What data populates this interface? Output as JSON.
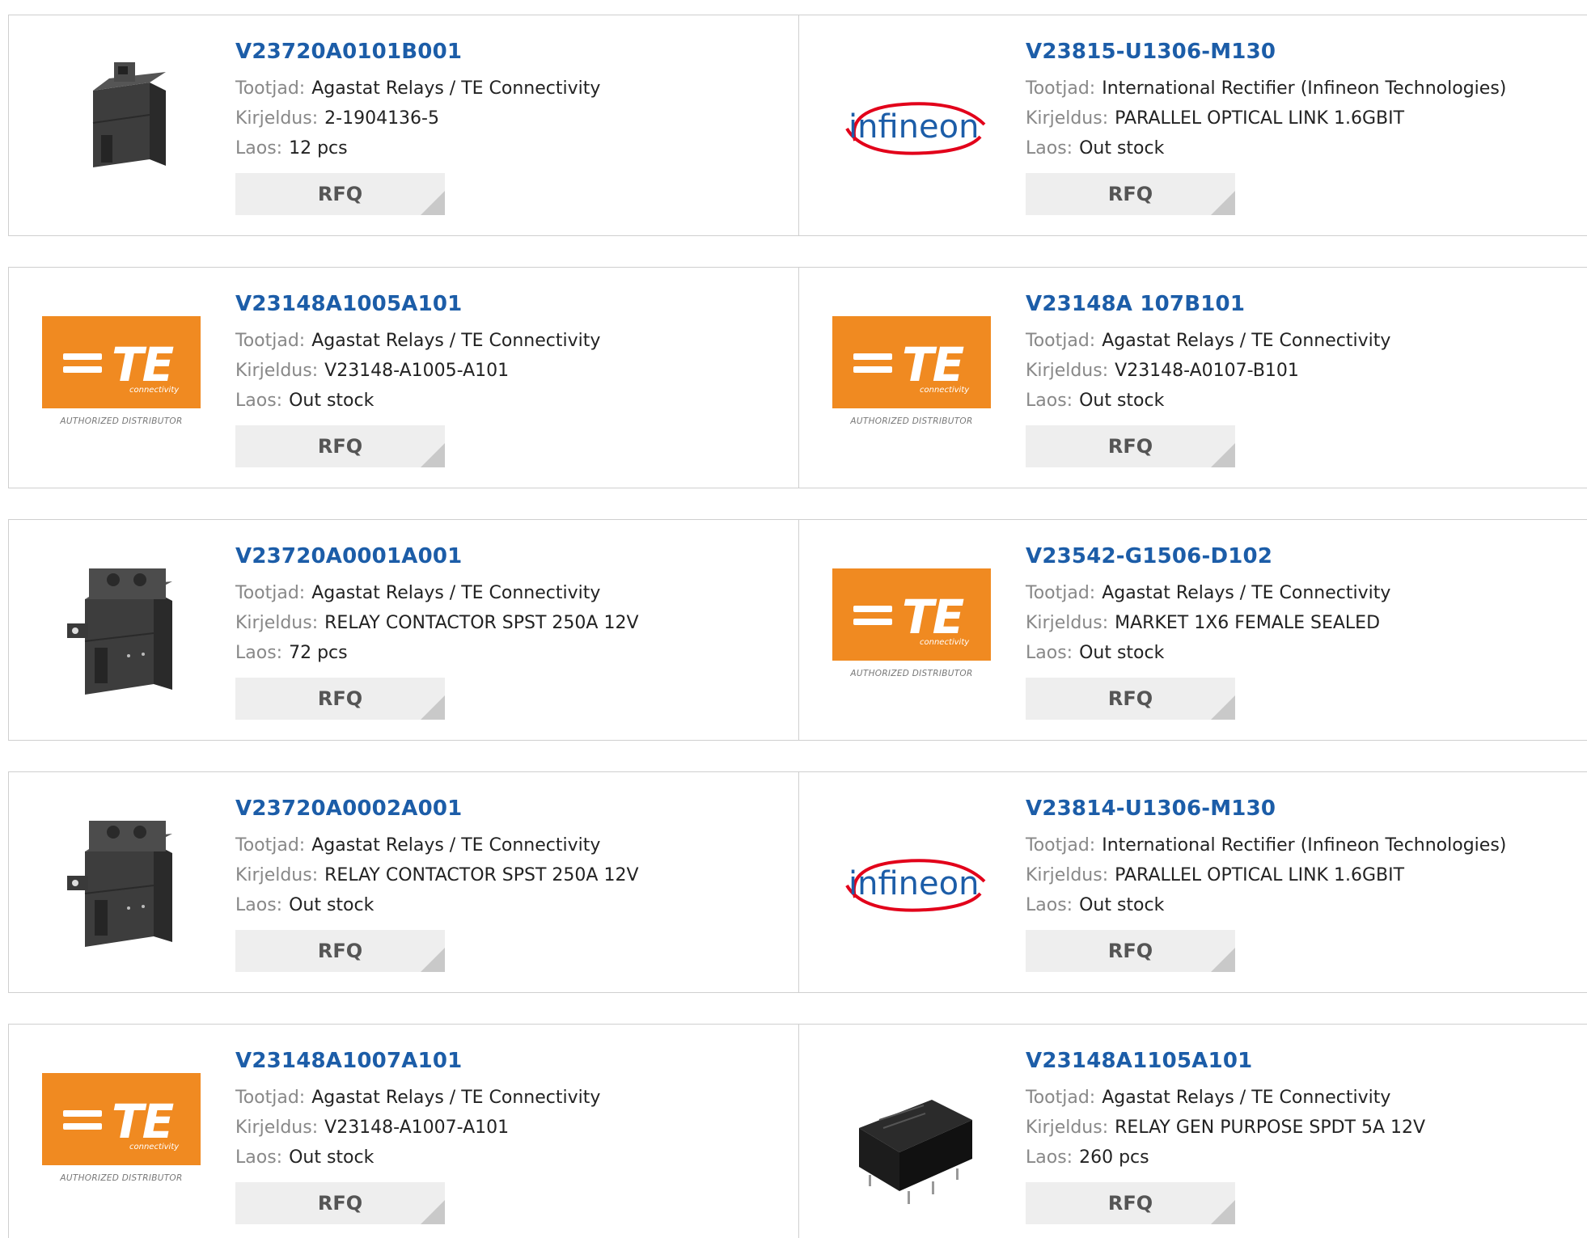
{
  "labels": {
    "manufacturer": "Tootjad:",
    "description": "Kirjeldus:",
    "stock": "Laos:",
    "rfq": "RFQ"
  },
  "logos": {
    "te_text": "TE",
    "te_sub": "connectivity",
    "te_caption": "AUTHORIZED DISTRIBUTOR",
    "infineon_text": "infineon"
  },
  "colors": {
    "link": "#1c5da8",
    "te_orange": "#f08a21",
    "infineon_red": "#e2001a",
    "infineon_blue": "#1c5da8"
  },
  "products": [
    {
      "pn": "V23720A0101B001",
      "manufacturer": "Agastat Relays / TE Connectivity",
      "description": "2-1904136-5",
      "stock": "12 pcs",
      "image": "relay-contactor-small-photo"
    },
    {
      "pn": "V23815-U1306-M130",
      "manufacturer": "International Rectifier (Infineon Technologies)",
      "description": "PARALLEL OPTICAL LINK 1.6GBIT",
      "stock": "Out stock",
      "image": "infineon-logo"
    },
    {
      "pn": "V23148A1005A101",
      "manufacturer": "Agastat Relays / TE Connectivity",
      "description": "V23148-A1005-A101",
      "stock": "Out stock",
      "image": "te-connectivity-logo"
    },
    {
      "pn": "V23148A 107B101",
      "manufacturer": "Agastat Relays / TE Connectivity",
      "description": "V23148-A0107-B101",
      "stock": "Out stock",
      "image": "te-connectivity-logo"
    },
    {
      "pn": "V23720A0001A001",
      "manufacturer": "Agastat Relays / TE Connectivity",
      "description": "RELAY CONTACTOR SPST 250A 12V",
      "stock": "72 pcs",
      "image": "relay-contactor-photo"
    },
    {
      "pn": "V23542-G1506-D102",
      "manufacturer": "Agastat Relays / TE Connectivity",
      "description": "MARKET 1X6 FEMALE SEALED",
      "stock": "Out stock",
      "image": "te-connectivity-logo"
    },
    {
      "pn": "V23720A0002A001",
      "manufacturer": "Agastat Relays / TE Connectivity",
      "description": "RELAY CONTACTOR SPST 250A 12V",
      "stock": "Out stock",
      "image": "relay-contactor-photo"
    },
    {
      "pn": "V23814-U1306-M130",
      "manufacturer": "International Rectifier (Infineon Technologies)",
      "description": "PARALLEL OPTICAL LINK 1.6GBIT",
      "stock": "Out stock",
      "image": "infineon-logo"
    },
    {
      "pn": "V23148A1007A101",
      "manufacturer": "Agastat Relays / TE Connectivity",
      "description": "V23148-A1007-A101",
      "stock": "Out stock",
      "image": "te-connectivity-logo"
    },
    {
      "pn": "V23148A1105A101",
      "manufacturer": "Agastat Relays / TE Connectivity",
      "description": "RELAY GEN PURPOSE SPDT 5A 12V",
      "stock": "260 pcs",
      "image": "pcb-relay-photo"
    }
  ]
}
